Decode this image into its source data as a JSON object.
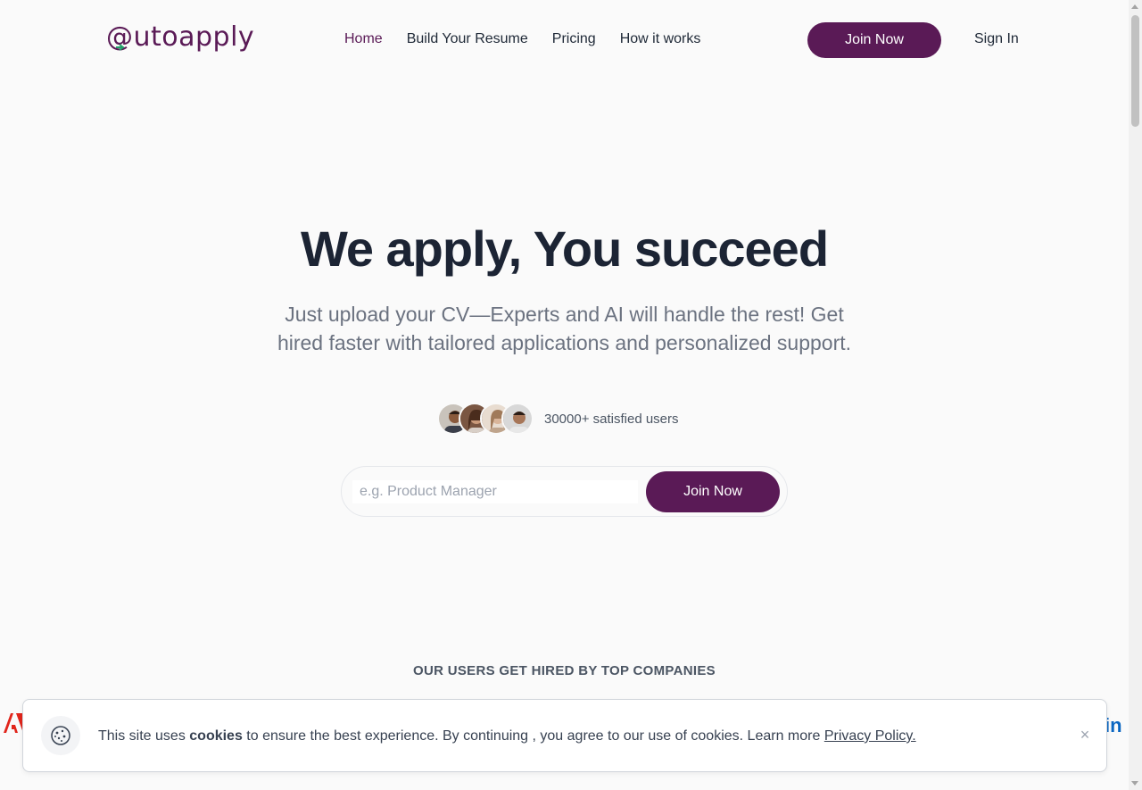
{
  "header": {
    "logo": "@utoapply",
    "nav": [
      {
        "label": "Home",
        "active": true
      },
      {
        "label": "Build Your Resume",
        "active": false
      },
      {
        "label": "Pricing",
        "active": false
      },
      {
        "label": "How it works",
        "active": false
      }
    ],
    "join_label": "Join Now",
    "signin_label": "Sign In"
  },
  "hero": {
    "title": "We apply, You succeed",
    "subtitle": "Just upload your CV—Experts and AI will handle the rest! Get hired faster with tailored applications and personalized support.",
    "users_text": "30000+ satisfied users",
    "search_placeholder": "e.g. Product Manager",
    "search_value": "",
    "join_label": "Join Now"
  },
  "companies": {
    "heading": "OUR USERS GET HIRED BY TOP COMPANIES"
  },
  "cookie": {
    "text_before": "This site uses ",
    "text_bold": "cookies",
    "text_after": " to ensure the best experience. By continuing , you agree to our use of cookies. Learn more ",
    "link": "Privacy Policy.",
    "close": "×"
  },
  "colors": {
    "brand": "#5a1a56",
    "accent_green": "#22a06b",
    "background": "#fafafa"
  }
}
